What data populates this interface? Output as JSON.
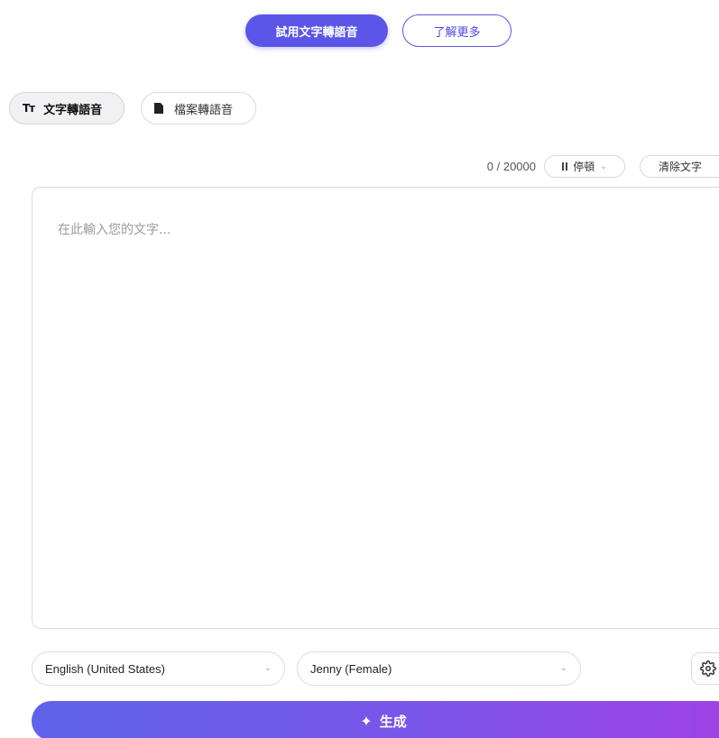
{
  "top_actions": {
    "primary_label": "試用文字轉語音",
    "secondary_label": "了解更多"
  },
  "mode_tabs": [
    {
      "icon": "text-size-icon",
      "icon_text": "Tт",
      "label": "文字轉語音"
    },
    {
      "icon": "file-icon",
      "label": "檔案轉語音"
    }
  ],
  "toolbar": {
    "char_count": "0 / 20000",
    "pause_label": "停頓",
    "clear_label": "清除文字"
  },
  "editor": {
    "placeholder": "在此輸入您的文字..."
  },
  "language_select": {
    "value": "English (United States)"
  },
  "voice_select": {
    "value": "Jenny (Female)"
  },
  "settings": {
    "icon": "gear-icon"
  },
  "generate": {
    "icon": "magic-wand-icon",
    "label": "生成"
  },
  "colors": {
    "accent": "#5b55e8",
    "gradient_start": "#5e63ea",
    "gradient_end": "#a042e6"
  }
}
